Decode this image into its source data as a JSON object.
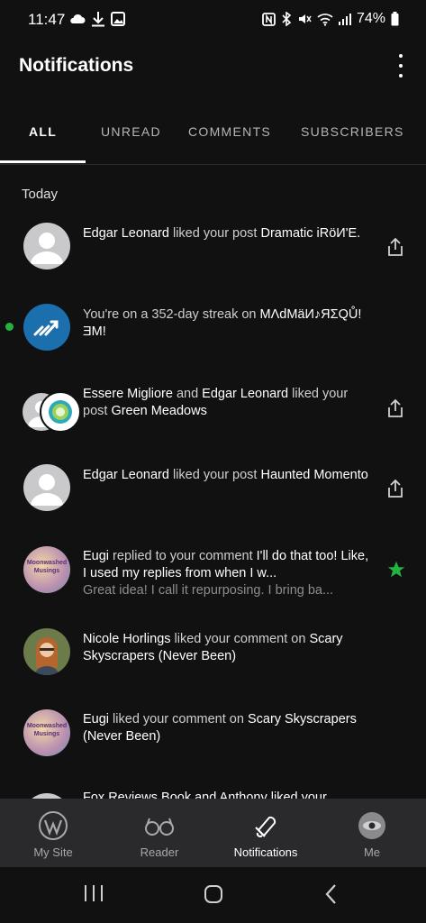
{
  "status": {
    "time": "11:47",
    "battery": "74%"
  },
  "appbar": {
    "title": "Notifications"
  },
  "tabs": [
    "ALL",
    "UNREAD",
    "COMMENTS",
    "SUBSCRIBERS"
  ],
  "section": "Today",
  "notifications": [
    {
      "actor": "Edgar Leonard",
      "action": " liked your post ",
      "target": "Dramatic iRöИ'E."
    },
    {
      "text1": "You're on a 352-day streak on ",
      "target": "MΛdMäИ♪ЯΣQŮ! ƎM!"
    },
    {
      "actor": "Essere Migliore",
      "mid": " and ",
      "actor2": "Edgar Leonard",
      "action": " liked your post ",
      "target": "Green Meadows"
    },
    {
      "actor": "Edgar Leonard",
      "action": " liked your post ",
      "target": "Haunted Momento"
    },
    {
      "actor": "Eugi",
      "action": " replied to your comment ",
      "target": "I'll do that too! Like, I used my replies from when I w...",
      "sub": "Great idea! I call it repurposing. I bring ba..."
    },
    {
      "actor": "Nicole Horlings",
      "action": " liked your comment on ",
      "target": "Scary Skyscrapers (Never Been)"
    },
    {
      "actor": "Eugi",
      "action": " liked your comment on ",
      "target": "Scary Skyscrapers (Never Been)"
    },
    {
      "partial": "Fox Reviews Book and Anthony liked your"
    }
  ],
  "avatar_text": {
    "moon": "Moonwashed Musings"
  },
  "nav": [
    "My Site",
    "Reader",
    "Notifications",
    "Me"
  ],
  "colors": {
    "accent_green": "#21b43f",
    "streak_blue": "#1c6fad"
  }
}
